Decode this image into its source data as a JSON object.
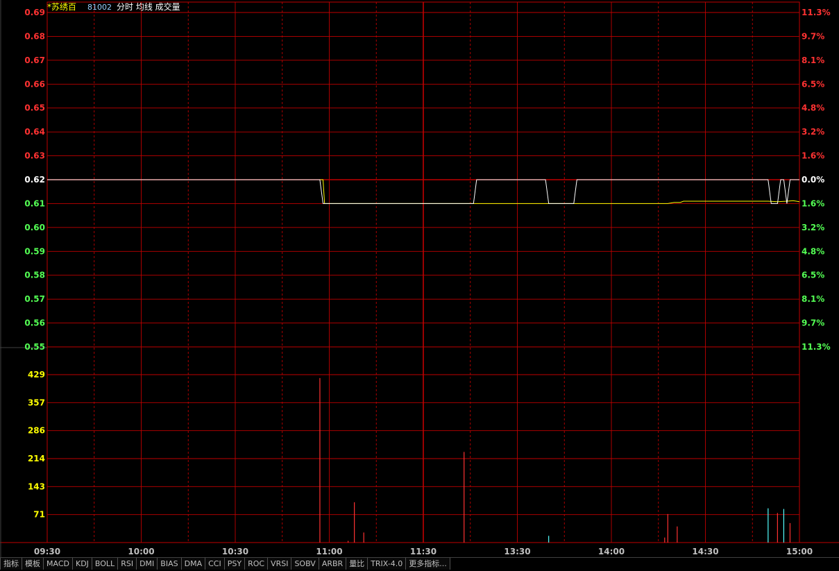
{
  "header": {
    "stock_name": "*苏绣百",
    "code": "81002",
    "mode_labels": "分时 均线 成交量"
  },
  "colors": {
    "grid": "#c00000",
    "up": "#ff3232",
    "down": "#54ff54",
    "neutral": "#ffffff",
    "volume_label": "#ffff00",
    "time_label": "#c0c0c0",
    "price_line": "#ffffff",
    "avg_line": "#ffff00",
    "vol_up": "#ff3232",
    "vol_down": "#54ffff"
  },
  "chart_data": {
    "type": "line",
    "prev_close": 0.62,
    "price_ticks_left": [
      "0.69",
      "0.68",
      "0.67",
      "0.66",
      "0.65",
      "0.64",
      "0.63",
      "0.62",
      "0.61",
      "0.60",
      "0.59",
      "0.58",
      "0.57",
      "0.56",
      "0.55"
    ],
    "pct_ticks_right": [
      "11.3%",
      "9.7%",
      "8.1%",
      "6.5%",
      "4.8%",
      "3.2%",
      "1.6%",
      "0.0%",
      "1.6%",
      "3.2%",
      "4.8%",
      "6.5%",
      "8.1%",
      "9.7%",
      "11.3%"
    ],
    "ylim": [
      0.55,
      0.69
    ],
    "volume_ticks": [
      "429",
      "357",
      "286",
      "214",
      "143",
      "71"
    ],
    "volume_max": 500,
    "time_labels": [
      "09:30",
      "10:00",
      "10:30",
      "11:00",
      "11:30",
      "13:30",
      "14:00",
      "14:30",
      "15:00"
    ],
    "total_minutes": 240,
    "price_series": [
      [
        0,
        0.62
      ],
      [
        87,
        0.62
      ],
      [
        88,
        0.61
      ],
      [
        136,
        0.61
      ],
      [
        137,
        0.62
      ],
      [
        159,
        0.62
      ],
      [
        160,
        0.61
      ],
      [
        168,
        0.61
      ],
      [
        169,
        0.62
      ],
      [
        230,
        0.62
      ],
      [
        231,
        0.61
      ],
      [
        233,
        0.61
      ],
      [
        234,
        0.62
      ],
      [
        235,
        0.62
      ],
      [
        236,
        0.61
      ],
      [
        237,
        0.62
      ],
      [
        240,
        0.62
      ]
    ],
    "avg_series": [
      [
        0,
        0.62
      ],
      [
        88,
        0.62
      ],
      [
        88.5,
        0.61
      ],
      [
        198,
        0.61
      ],
      [
        200,
        0.6105
      ],
      [
        202,
        0.6105
      ],
      [
        203,
        0.611
      ],
      [
        230,
        0.611
      ],
      [
        233,
        0.6108
      ],
      [
        236,
        0.611
      ],
      [
        238,
        0.6112
      ],
      [
        240,
        0.6108
      ]
    ],
    "volume_bars": [
      {
        "t": 87,
        "v": 490,
        "dir": "up"
      },
      {
        "t": 96,
        "v": 5,
        "dir": "up"
      },
      {
        "t": 98,
        "v": 120,
        "dir": "up"
      },
      {
        "t": 101,
        "v": 30,
        "dir": "up"
      },
      {
        "t": 133,
        "v": 270,
        "dir": "up"
      },
      {
        "t": 160,
        "v": 20,
        "dir": "down"
      },
      {
        "t": 197,
        "v": 15,
        "dir": "up"
      },
      {
        "t": 198,
        "v": 85,
        "dir": "up"
      },
      {
        "t": 201,
        "v": 48,
        "dir": "up"
      },
      {
        "t": 230,
        "v": 102,
        "dir": "down"
      },
      {
        "t": 233,
        "v": 88,
        "dir": "up"
      },
      {
        "t": 235,
        "v": 100,
        "dir": "down"
      },
      {
        "t": 237,
        "v": 58,
        "dir": "up"
      }
    ]
  },
  "bottom_tabs": [
    "指标",
    "模板",
    "MACD",
    "KDJ",
    "BOLL",
    "RSI",
    "DMI",
    "BIAS",
    "DMA",
    "CCI",
    "PSY",
    "ROC",
    "VRSI",
    "SOBV",
    "ARBR",
    "量比",
    "TRIX-4.0",
    "更多指标..."
  ]
}
